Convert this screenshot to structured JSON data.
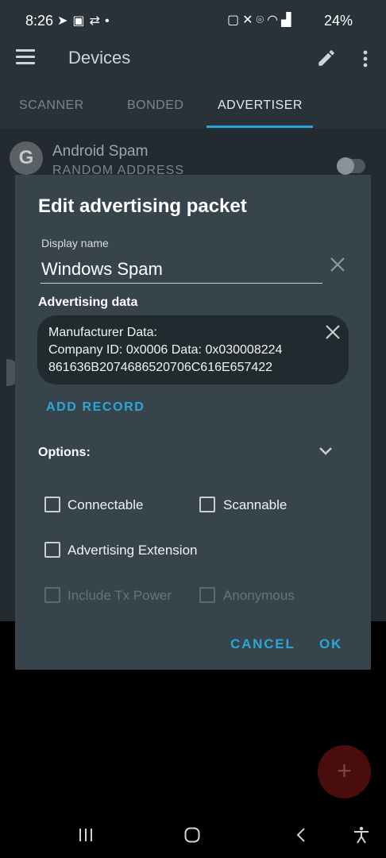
{
  "status_bar": {
    "time": "8:26",
    "battery": "24%",
    "left_icons": [
      "telegram-icon",
      "notification-icon",
      "sync-icon",
      "dot-icon"
    ],
    "right_icons": [
      "nfc-icon",
      "mute-icon",
      "location-icon",
      "wifi-icon",
      "signal-icon",
      "signal-icon",
      "battery-icon"
    ]
  },
  "app_bar": {
    "title": "Devices",
    "tabs": [
      {
        "label": "SCANNER"
      },
      {
        "label": "BONDED"
      },
      {
        "label": "ADVERTISER",
        "active": true
      }
    ]
  },
  "background_list": {
    "item": {
      "avatar_letter": "G",
      "name": "Android Spam",
      "subtitle": "RANDOM ADDRESS"
    }
  },
  "dialog": {
    "title": "Edit advertising packet",
    "display_name_label": "Display name",
    "display_name_value": "Windows Spam",
    "advertising_data_heading": "Advertising data",
    "record": {
      "title": "Manufacturer Data:",
      "line2": "Company ID: 0x0006 Data: 0x030008224",
      "line3": "861636B2074686520706C616E657422"
    },
    "add_record": "ADD RECORD",
    "options_label": "Options:",
    "checkboxes": [
      {
        "label": "Connectable",
        "checked": false,
        "enabled": true
      },
      {
        "label": "Scannable",
        "checked": false,
        "enabled": true
      },
      {
        "label": "Advertising Extension",
        "checked": false,
        "enabled": true
      },
      {
        "label": "Include Tx Power",
        "checked": false,
        "enabled": false
      },
      {
        "label": "Anonymous",
        "checked": false,
        "enabled": false
      }
    ],
    "cancel": "CANCEL",
    "ok": "OK"
  },
  "fab": {
    "label": "+"
  },
  "colors": {
    "accent": "#2aa7d8",
    "dialog_bg": "#37444c",
    "appbar_bg": "#283238",
    "fab": "#4a0d0d"
  }
}
